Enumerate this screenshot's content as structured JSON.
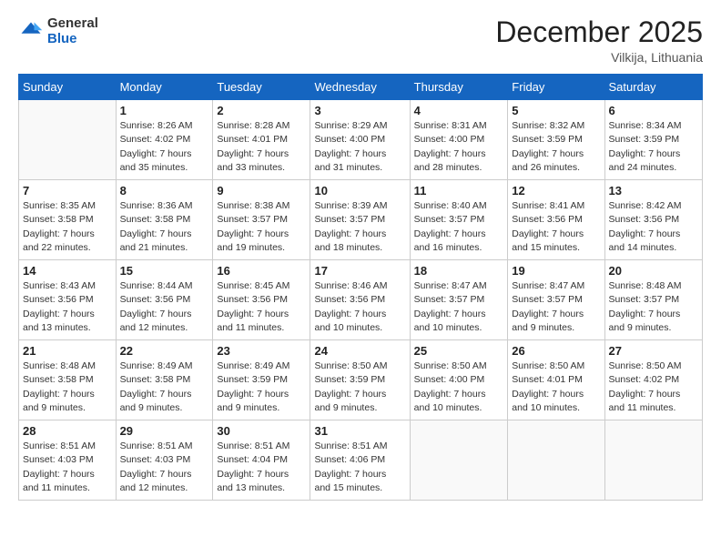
{
  "header": {
    "logo_general": "General",
    "logo_blue": "Blue",
    "month_title": "December 2025",
    "location": "Vilkija, Lithuania"
  },
  "days_of_week": [
    "Sunday",
    "Monday",
    "Tuesday",
    "Wednesday",
    "Thursday",
    "Friday",
    "Saturday"
  ],
  "weeks": [
    [
      {
        "day": "",
        "info": ""
      },
      {
        "day": "1",
        "info": "Sunrise: 8:26 AM\nSunset: 4:02 PM\nDaylight: 7 hours\nand 35 minutes."
      },
      {
        "day": "2",
        "info": "Sunrise: 8:28 AM\nSunset: 4:01 PM\nDaylight: 7 hours\nand 33 minutes."
      },
      {
        "day": "3",
        "info": "Sunrise: 8:29 AM\nSunset: 4:00 PM\nDaylight: 7 hours\nand 31 minutes."
      },
      {
        "day": "4",
        "info": "Sunrise: 8:31 AM\nSunset: 4:00 PM\nDaylight: 7 hours\nand 28 minutes."
      },
      {
        "day": "5",
        "info": "Sunrise: 8:32 AM\nSunset: 3:59 PM\nDaylight: 7 hours\nand 26 minutes."
      },
      {
        "day": "6",
        "info": "Sunrise: 8:34 AM\nSunset: 3:59 PM\nDaylight: 7 hours\nand 24 minutes."
      }
    ],
    [
      {
        "day": "7",
        "info": "Sunrise: 8:35 AM\nSunset: 3:58 PM\nDaylight: 7 hours\nand 22 minutes."
      },
      {
        "day": "8",
        "info": "Sunrise: 8:36 AM\nSunset: 3:58 PM\nDaylight: 7 hours\nand 21 minutes."
      },
      {
        "day": "9",
        "info": "Sunrise: 8:38 AM\nSunset: 3:57 PM\nDaylight: 7 hours\nand 19 minutes."
      },
      {
        "day": "10",
        "info": "Sunrise: 8:39 AM\nSunset: 3:57 PM\nDaylight: 7 hours\nand 18 minutes."
      },
      {
        "day": "11",
        "info": "Sunrise: 8:40 AM\nSunset: 3:57 PM\nDaylight: 7 hours\nand 16 minutes."
      },
      {
        "day": "12",
        "info": "Sunrise: 8:41 AM\nSunset: 3:56 PM\nDaylight: 7 hours\nand 15 minutes."
      },
      {
        "day": "13",
        "info": "Sunrise: 8:42 AM\nSunset: 3:56 PM\nDaylight: 7 hours\nand 14 minutes."
      }
    ],
    [
      {
        "day": "14",
        "info": "Sunrise: 8:43 AM\nSunset: 3:56 PM\nDaylight: 7 hours\nand 13 minutes."
      },
      {
        "day": "15",
        "info": "Sunrise: 8:44 AM\nSunset: 3:56 PM\nDaylight: 7 hours\nand 12 minutes."
      },
      {
        "day": "16",
        "info": "Sunrise: 8:45 AM\nSunset: 3:56 PM\nDaylight: 7 hours\nand 11 minutes."
      },
      {
        "day": "17",
        "info": "Sunrise: 8:46 AM\nSunset: 3:56 PM\nDaylight: 7 hours\nand 10 minutes."
      },
      {
        "day": "18",
        "info": "Sunrise: 8:47 AM\nSunset: 3:57 PM\nDaylight: 7 hours\nand 10 minutes."
      },
      {
        "day": "19",
        "info": "Sunrise: 8:47 AM\nSunset: 3:57 PM\nDaylight: 7 hours\nand 9 minutes."
      },
      {
        "day": "20",
        "info": "Sunrise: 8:48 AM\nSunset: 3:57 PM\nDaylight: 7 hours\nand 9 minutes."
      }
    ],
    [
      {
        "day": "21",
        "info": "Sunrise: 8:48 AM\nSunset: 3:58 PM\nDaylight: 7 hours\nand 9 minutes."
      },
      {
        "day": "22",
        "info": "Sunrise: 8:49 AM\nSunset: 3:58 PM\nDaylight: 7 hours\nand 9 minutes."
      },
      {
        "day": "23",
        "info": "Sunrise: 8:49 AM\nSunset: 3:59 PM\nDaylight: 7 hours\nand 9 minutes."
      },
      {
        "day": "24",
        "info": "Sunrise: 8:50 AM\nSunset: 3:59 PM\nDaylight: 7 hours\nand 9 minutes."
      },
      {
        "day": "25",
        "info": "Sunrise: 8:50 AM\nSunset: 4:00 PM\nDaylight: 7 hours\nand 10 minutes."
      },
      {
        "day": "26",
        "info": "Sunrise: 8:50 AM\nSunset: 4:01 PM\nDaylight: 7 hours\nand 10 minutes."
      },
      {
        "day": "27",
        "info": "Sunrise: 8:50 AM\nSunset: 4:02 PM\nDaylight: 7 hours\nand 11 minutes."
      }
    ],
    [
      {
        "day": "28",
        "info": "Sunrise: 8:51 AM\nSunset: 4:03 PM\nDaylight: 7 hours\nand 11 minutes."
      },
      {
        "day": "29",
        "info": "Sunrise: 8:51 AM\nSunset: 4:03 PM\nDaylight: 7 hours\nand 12 minutes."
      },
      {
        "day": "30",
        "info": "Sunrise: 8:51 AM\nSunset: 4:04 PM\nDaylight: 7 hours\nand 13 minutes."
      },
      {
        "day": "31",
        "info": "Sunrise: 8:51 AM\nSunset: 4:06 PM\nDaylight: 7 hours\nand 15 minutes."
      },
      {
        "day": "",
        "info": ""
      },
      {
        "day": "",
        "info": ""
      },
      {
        "day": "",
        "info": ""
      }
    ]
  ]
}
